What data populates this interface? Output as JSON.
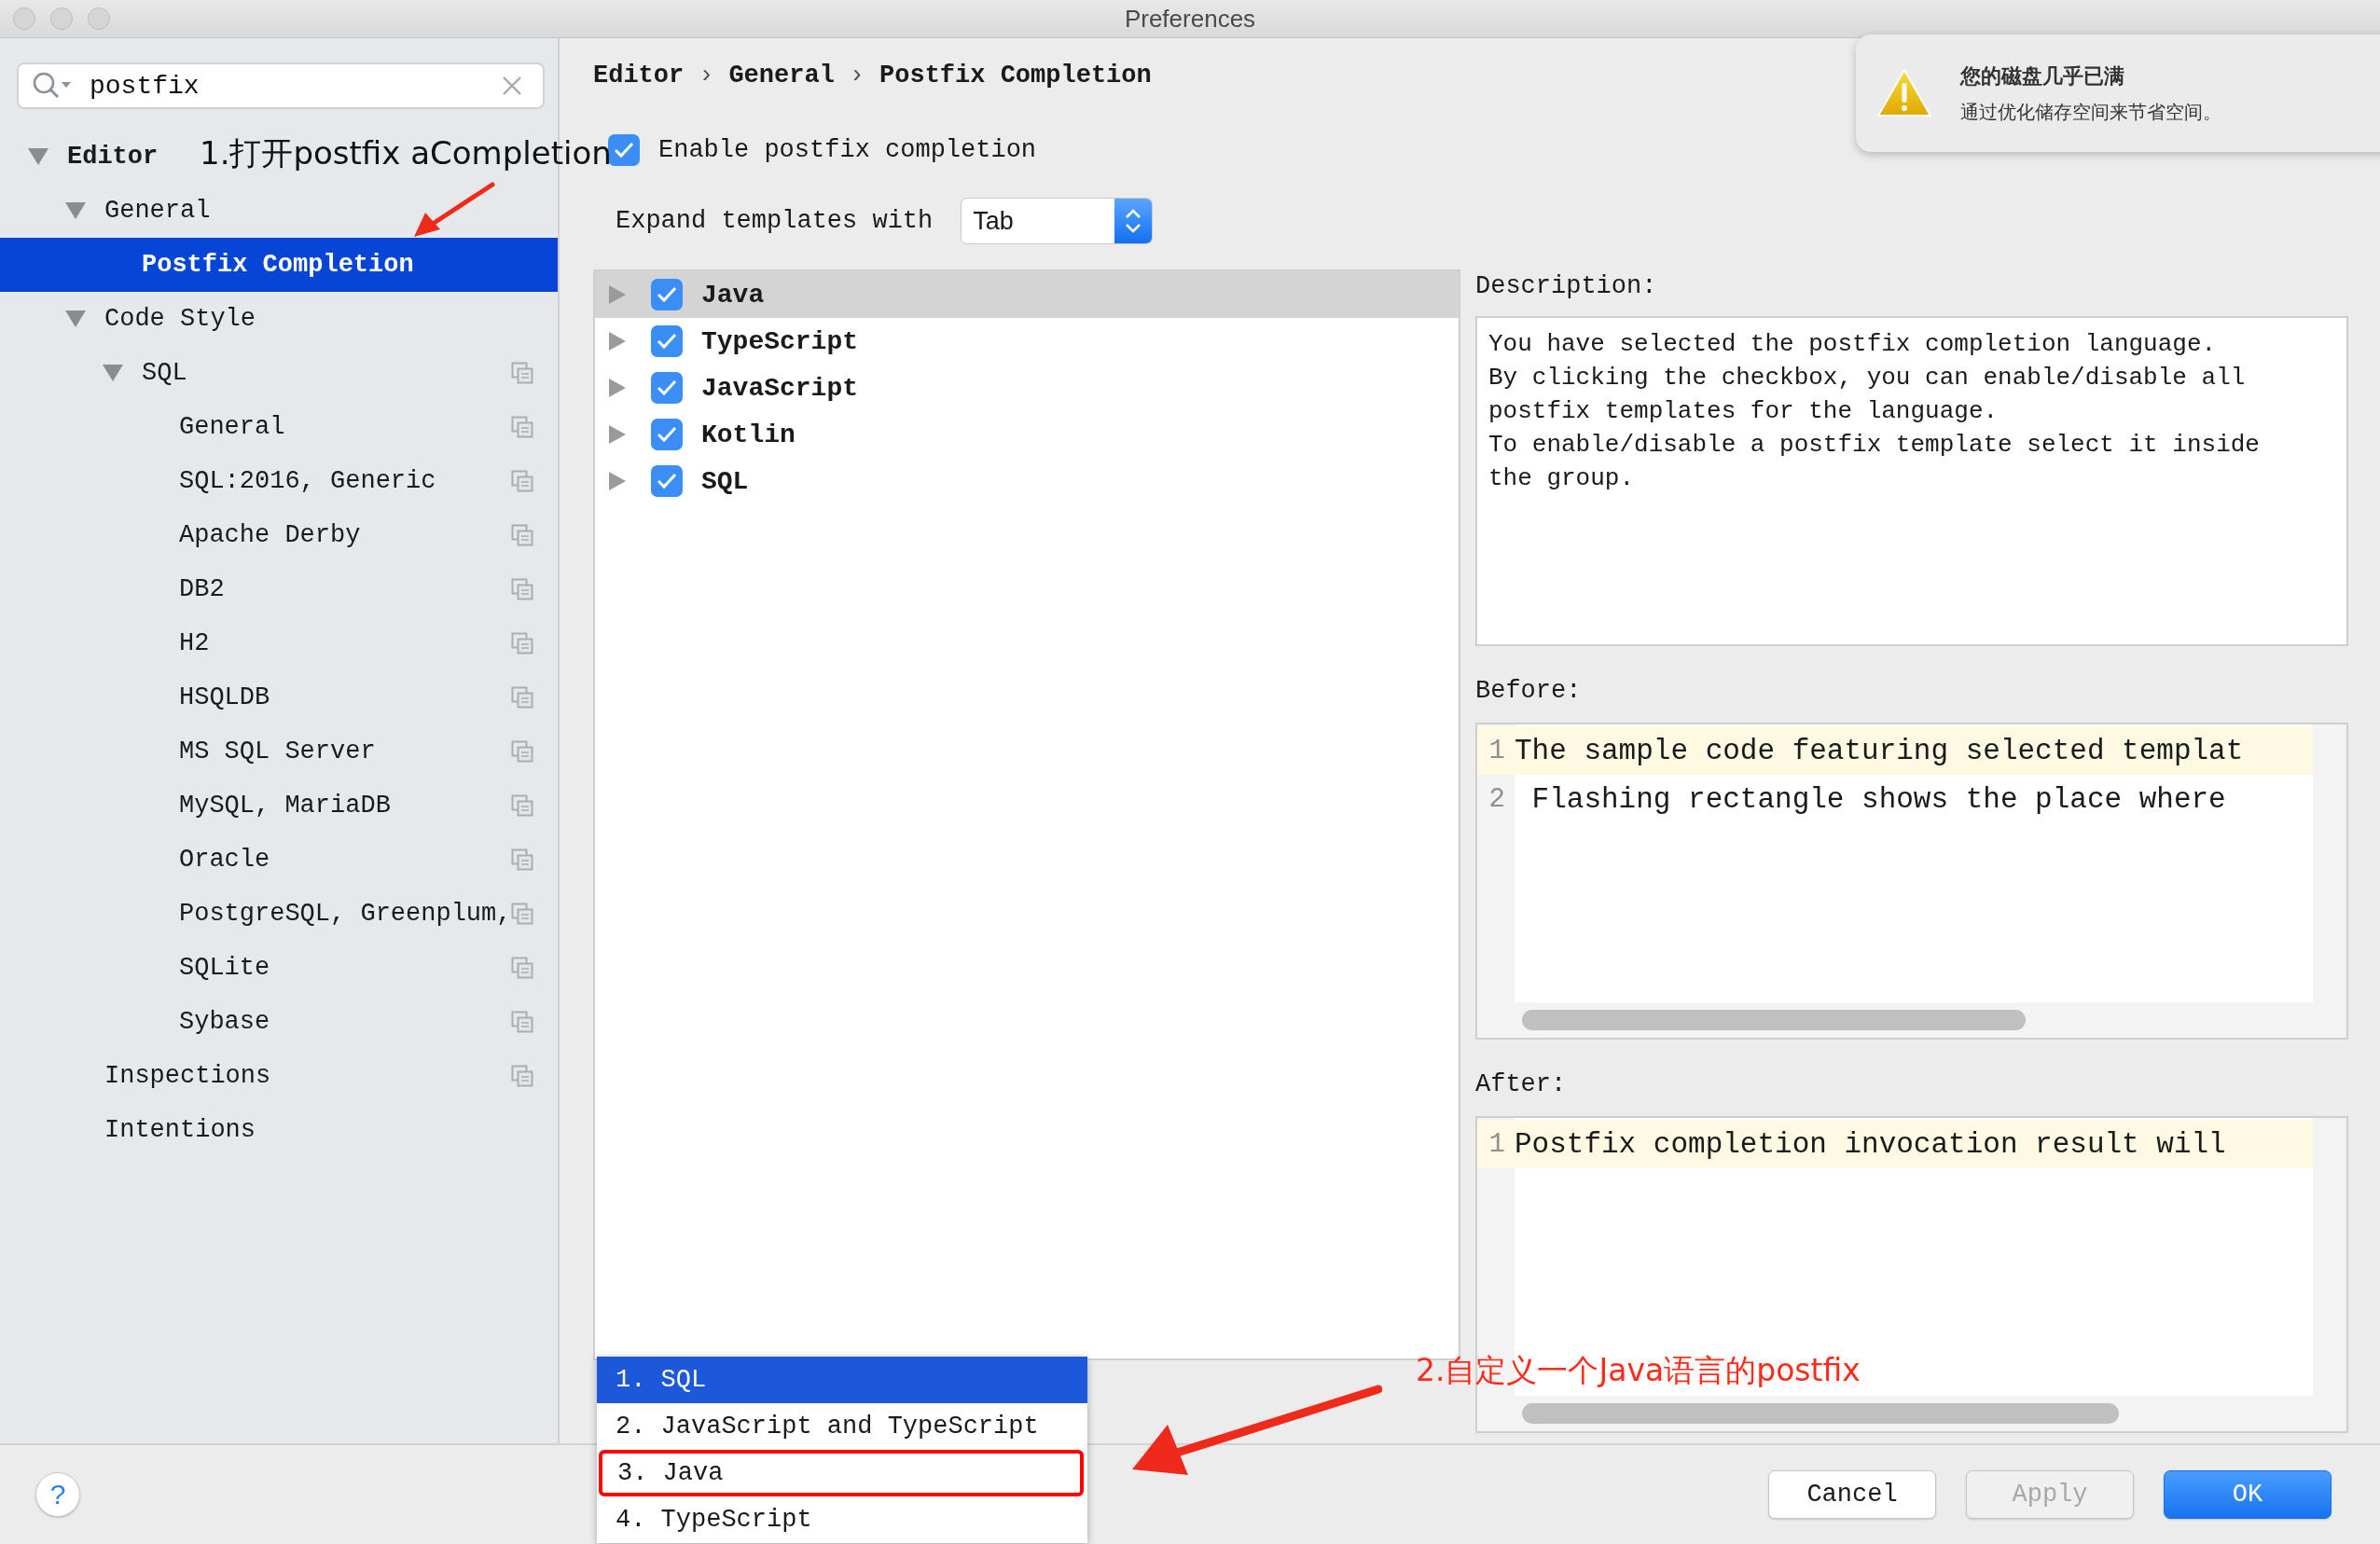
{
  "window": {
    "title": "Preferences"
  },
  "search": {
    "value": "postfix"
  },
  "tree": [
    {
      "label": "Editor",
      "bold": true,
      "expanded": true,
      "selected": false,
      "scheme_icon": false,
      "children": [
        {
          "label": "General",
          "bold": false,
          "expanded": true,
          "selected": false,
          "scheme_icon": false,
          "children": [
            {
              "label": "Postfix Completion",
              "bold": true,
              "selected": true,
              "scheme_icon": false
            }
          ]
        },
        {
          "label": "Code Style",
          "bold": false,
          "expanded": true,
          "selected": false,
          "scheme_icon": false,
          "children": [
            {
              "label": "SQL",
              "bold": false,
              "expanded": true,
              "selected": false,
              "scheme_icon": true,
              "children": [
                {
                  "label": "General",
                  "bold": false,
                  "selected": false,
                  "scheme_icon": true
                },
                {
                  "label": "SQL:2016, Generic",
                  "bold": false,
                  "selected": false,
                  "scheme_icon": true
                },
                {
                  "label": "Apache Derby",
                  "bold": false,
                  "selected": false,
                  "scheme_icon": true
                },
                {
                  "label": "DB2",
                  "bold": false,
                  "selected": false,
                  "scheme_icon": true
                },
                {
                  "label": "H2",
                  "bold": false,
                  "selected": false,
                  "scheme_icon": true
                },
                {
                  "label": "HSQLDB",
                  "bold": false,
                  "selected": false,
                  "scheme_icon": true
                },
                {
                  "label": "MS SQL Server",
                  "bold": false,
                  "selected": false,
                  "scheme_icon": true
                },
                {
                  "label": "MySQL, MariaDB",
                  "bold": false,
                  "selected": false,
                  "scheme_icon": true
                },
                {
                  "label": "Oracle",
                  "bold": false,
                  "selected": false,
                  "scheme_icon": true
                },
                {
                  "label": "PostgreSQL, Greenplum,",
                  "bold": false,
                  "selected": false,
                  "scheme_icon": true
                },
                {
                  "label": "SQLite",
                  "bold": false,
                  "selected": false,
                  "scheme_icon": true
                },
                {
                  "label": "Sybase",
                  "bold": false,
                  "selected": false,
                  "scheme_icon": true
                }
              ]
            }
          ]
        },
        {
          "label": "Inspections",
          "bold": false,
          "selected": false,
          "scheme_icon": true
        },
        {
          "label": "Intentions",
          "bold": false,
          "selected": false,
          "scheme_icon": false
        }
      ]
    }
  ],
  "breadcrumbs": [
    "Editor",
    "General",
    "Postfix Completion"
  ],
  "breadcrumb_separators": [
    "›",
    "›"
  ],
  "enable": {
    "label": "Enable postfix completion",
    "checked": true
  },
  "expand": {
    "label": "Expand templates with",
    "value": "Tab"
  },
  "templates": [
    {
      "label": "Java",
      "checked": true,
      "selected": true,
      "expanded": false
    },
    {
      "label": "TypeScript",
      "checked": true,
      "selected": false,
      "expanded": false
    },
    {
      "label": "JavaScript",
      "checked": true,
      "selected": false,
      "expanded": false
    },
    {
      "label": "Kotlin",
      "checked": true,
      "selected": false,
      "expanded": false
    },
    {
      "label": "SQL",
      "checked": true,
      "selected": false,
      "expanded": false
    }
  ],
  "description": {
    "label": "Description:",
    "lines": [
      "You have selected the postfix completion language.",
      "By clicking the checkbox, you can enable/disable all",
      "postfix templates for the language.",
      "To enable/disable a postfix template select it inside",
      "the group."
    ]
  },
  "before": {
    "label": "Before:",
    "lines": [
      {
        "number": "1",
        "text": "The sample code featuring selected templat",
        "current": true
      },
      {
        "number": "2",
        "text": " Flashing rectangle shows the place where",
        "current": false
      }
    ]
  },
  "after": {
    "label": "After:",
    "lines": [
      {
        "number": "1",
        "text": "Postfix completion invocation result will",
        "current": true
      }
    ]
  },
  "popup": [
    {
      "label": "1. SQL",
      "selected": true,
      "circled": false
    },
    {
      "label": "2. JavaScript and TypeScript",
      "selected": false,
      "circled": false
    },
    {
      "label": "3. Java",
      "selected": false,
      "circled": true
    },
    {
      "label": "4. TypeScript",
      "selected": false,
      "circled": false
    }
  ],
  "buttons": [
    {
      "label": "Cancel",
      "kind": "normal",
      "disabled": false
    },
    {
      "label": "Apply",
      "kind": "normal",
      "disabled": true
    },
    {
      "label": "OK",
      "kind": "default",
      "disabled": false
    }
  ],
  "help": {
    "label": "?"
  },
  "notification": {
    "title": "您的磁盘几乎已满",
    "message": "通过优化储存空间来节省空间。"
  },
  "notes": [
    {
      "text": "1.打开postfix aCompletion",
      "color": "#111111"
    },
    {
      "text": "2.自定义一个Java语言的postfix",
      "color": "#ff2a1a"
    }
  ]
}
